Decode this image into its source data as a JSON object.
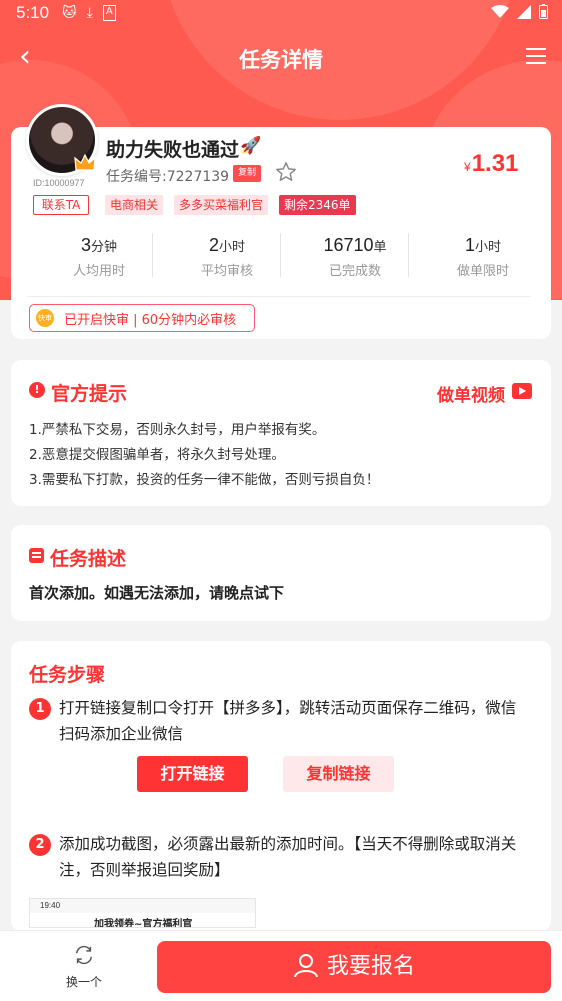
{
  "status_bar": {
    "time": "5:10",
    "left_icons": [
      "cat-icon",
      "download-icon",
      "a-icon"
    ],
    "right_icons": [
      "wifi-icon",
      "signal-icon",
      "battery-icon"
    ]
  },
  "nav": {
    "back_icon": "back-chevron-icon",
    "title": "任务详情",
    "menu_icon": "menu-icon"
  },
  "task": {
    "user_id": "ID:10000977",
    "contact_label": "联系TA",
    "title": "助力失败也通过",
    "title_emoji": "🚀",
    "task_number": "任务编号:7227139",
    "copy_label": "复制",
    "price_symbol": "¥",
    "price": "1.31",
    "tags": [
      "电商相关",
      "多多买菜福利官",
      "剩余2346单"
    ],
    "stats": [
      {
        "value": "3",
        "unit": "分钟",
        "label": "人均用时"
      },
      {
        "value": "2",
        "unit": "小时",
        "label": "平均审核"
      },
      {
        "value": "16710",
        "unit": "单",
        "label": "已完成数"
      },
      {
        "value": "1",
        "unit": "小时",
        "label": "做单限时"
      }
    ],
    "fast_review_badge": "快审",
    "fast_review": "已开启快审 | 60分钟内必审核"
  },
  "notice": {
    "title": "官方提示",
    "video_link": "做单视频",
    "rules": [
      "1.严禁私下交易，否则永久封号，用户举报有奖。",
      "2.恶意提交假图骗单者，将永久封号处理。",
      "3.需要私下打款，投资的任务一律不能做，否则亏损自负！"
    ]
  },
  "description": {
    "title": "任务描述",
    "text": "首次添加。如遇无法添加，请晚点试下"
  },
  "steps": {
    "title": "任务步骤",
    "items": [
      {
        "number": "1",
        "text": "打开链接复制口令打开【拼多多】，跳转活动页面保存二维码，微信扫码添加企业微信"
      },
      {
        "number": "2",
        "text": "添加成功截图，必须露出最新的添加时间。【当天不得删除或取消关注，否则举报追回奖励】"
      }
    ],
    "open_link_label": "打开链接",
    "copy_link_label": "复制链接",
    "screenshot_time": "19:40",
    "screenshot_caption": "加我领券~官方福利官"
  },
  "bottom": {
    "swap_label": "换一个",
    "signup_label": "我要报名"
  },
  "colors": {
    "accent": "#ff3333",
    "header_bg": "#ff5a4f",
    "page_bg": "#f3f3f3"
  }
}
